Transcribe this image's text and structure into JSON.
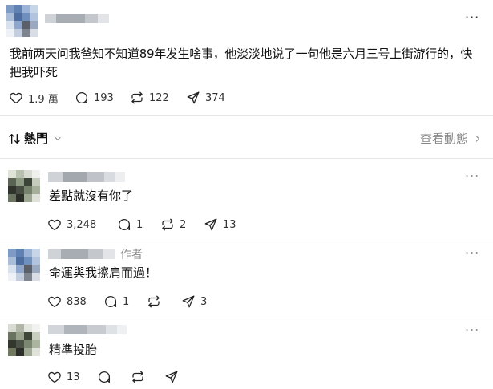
{
  "post": {
    "text_line1": "我前两天问我爸知不知道89年发生啥事，他淡淡地说了一句他是六月三号上街游行的，快",
    "text_line2": "把我吓死",
    "likes": "1.9 萬",
    "comments": "193",
    "reposts": "122",
    "shares": "374",
    "more": "···"
  },
  "sort": {
    "label": "熱門",
    "arrow_icon": "sort-arrows-icon",
    "view_activity": "查看動態"
  },
  "replies": [
    {
      "text": "差點就沒有你了",
      "likes": "3,248",
      "comments": "1",
      "reposts": "2",
      "shares": "13",
      "author_tag": "",
      "more": "···"
    },
    {
      "text": "命運與我擦肩而過！",
      "likes": "838",
      "comments": "1",
      "reposts": "",
      "shares": "3",
      "author_tag": "作者",
      "more": "···"
    },
    {
      "text": "精準投胎",
      "likes": "13",
      "comments": "",
      "reposts": "",
      "shares": "",
      "author_tag": "",
      "more": "···"
    }
  ],
  "colors": {
    "divider": "#e6e6e6",
    "muted": "#888888"
  }
}
